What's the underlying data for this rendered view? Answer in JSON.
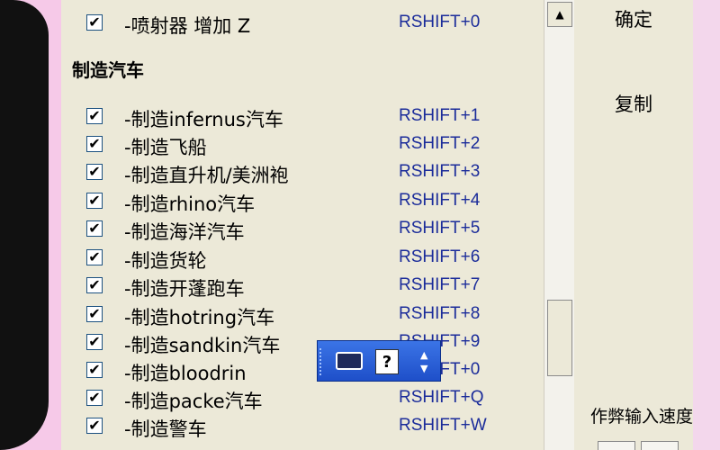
{
  "list": {
    "items": [
      {
        "label": "-喷射器 增加 Z",
        "key": "RSHIFT+0",
        "checked": true
      },
      {
        "label": "-制造infernus汽车",
        "key": "RSHIFT+1",
        "checked": true
      },
      {
        "label": "-制造飞船",
        "key": "RSHIFT+2",
        "checked": true
      },
      {
        "label": "-制造直升机/美洲袍",
        "key": "RSHIFT+3",
        "checked": true
      },
      {
        "label": "-制造rhino汽车",
        "key": "RSHIFT+4",
        "checked": true
      },
      {
        "label": "-制造海洋汽车",
        "key": "RSHIFT+5",
        "checked": true
      },
      {
        "label": "-制造货轮",
        "key": "RSHIFT+6",
        "checked": true
      },
      {
        "label": "-制造开蓬跑车",
        "key": "RSHIFT+7",
        "checked": true
      },
      {
        "label": "-制造hotring汽车",
        "key": "RSHIFT+8",
        "checked": true
      },
      {
        "label": "-制造sandkin汽车",
        "key": "RSHIFT+9",
        "checked": true
      },
      {
        "label": "-制造bloodrin",
        "key": "RSHIFT+0",
        "checked": true
      },
      {
        "label": "-制造packe汽车",
        "key": "RSHIFT+Q",
        "checked": true
      },
      {
        "label": "-制造警车",
        "key": "RSHIFT+W",
        "checked": true
      }
    ],
    "section_title": "制造汽车",
    "check_glyph": "✔"
  },
  "buttons": {
    "confirm": "确定",
    "copy": "复制"
  },
  "speed_label": "作弊输入速度",
  "ime": {
    "help_glyph": "?",
    "up": "▲",
    "down": "▼"
  },
  "scroll": {
    "up_glyph": "▲"
  }
}
